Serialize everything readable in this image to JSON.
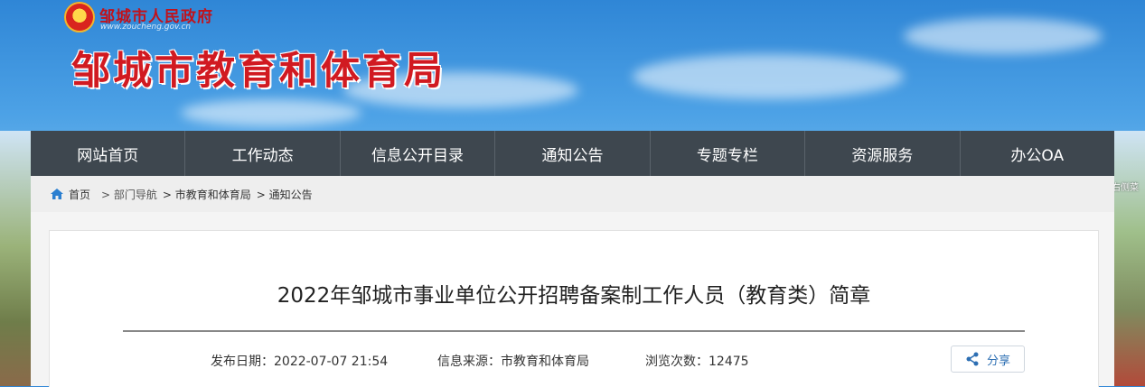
{
  "header": {
    "gov_name": "邹城市人民政府",
    "gov_url": "www.zoucheng.gov.cn",
    "bureau_title": "邹城市教育和体育局"
  },
  "nav": {
    "items": [
      "网站首页",
      "工作动态",
      "信息公开目录",
      "通知公告",
      "专题专栏",
      "资源服务",
      "办公OA"
    ]
  },
  "breadcrumb": {
    "home": "首页",
    "items": [
      "> 部门导航",
      "> 市教育和体育局",
      "> 通知公告"
    ]
  },
  "article": {
    "title": "2022年邹城市事业单位公开招聘备案制工作人员（教育类）简章",
    "publish_date": "发布日期：2022-07-07 21:54",
    "source": "信息来源：市教育和体育局",
    "views": "浏览次数：12475",
    "share_label": "分享"
  },
  "side_hint": "滚动右侧菜"
}
